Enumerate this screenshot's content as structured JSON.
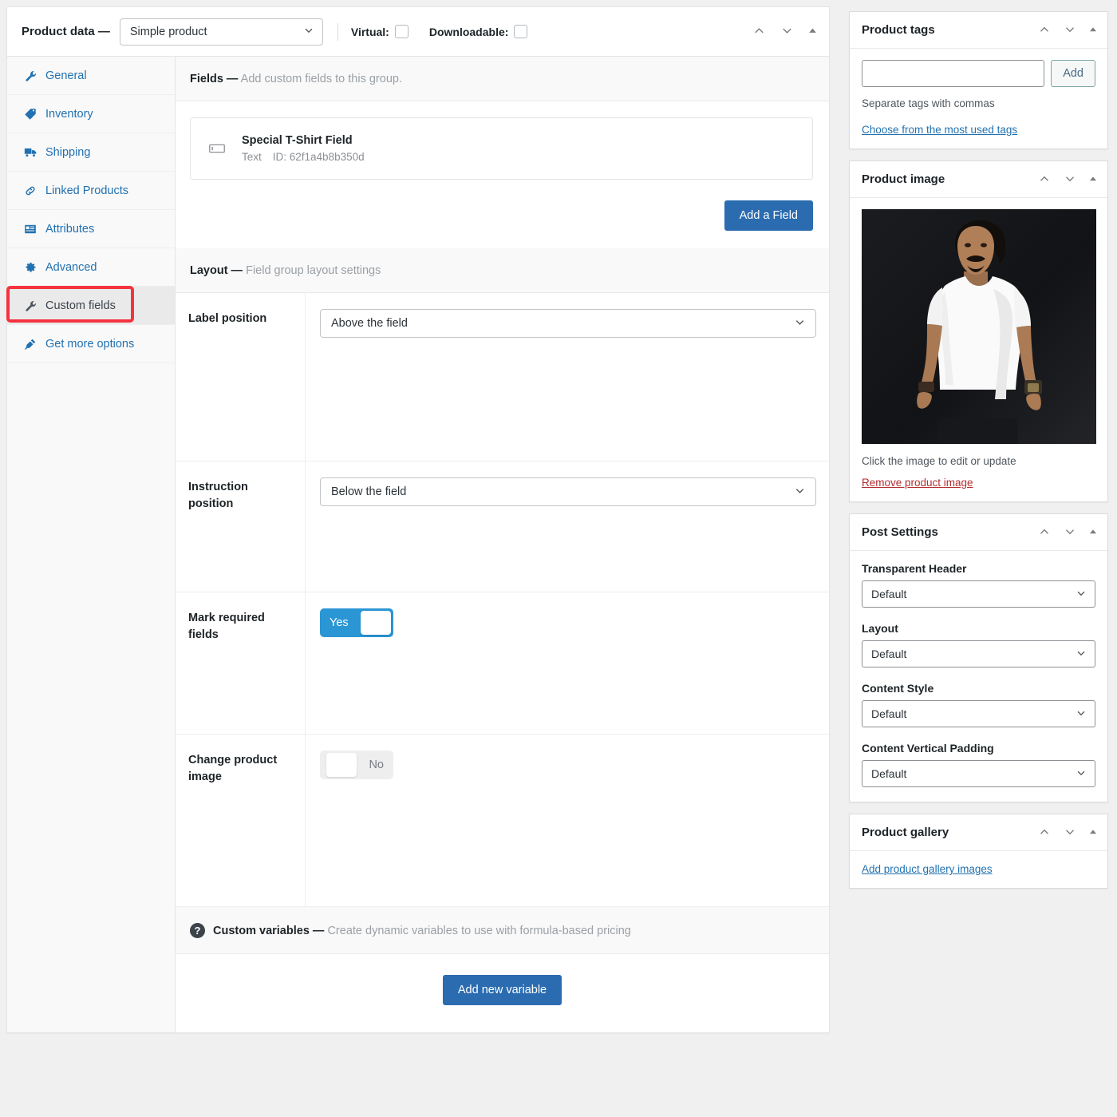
{
  "product_data": {
    "title": "Product data —",
    "type_select": {
      "value": "Simple product",
      "icon": "chevron-down-icon"
    },
    "virtual": {
      "label": "Virtual:",
      "checked": false
    },
    "downloadable": {
      "label": "Downloadable:",
      "checked": false
    },
    "header_controls": [
      "chevron-up-icon",
      "chevron-down-icon",
      "caret-up-icon"
    ],
    "tabs": [
      {
        "label": "General",
        "icon": "wrench-icon",
        "active": false
      },
      {
        "label": "Inventory",
        "icon": "tag-icon",
        "active": false
      },
      {
        "label": "Shipping",
        "icon": "truck-icon",
        "active": false
      },
      {
        "label": "Linked Products",
        "icon": "link-icon",
        "active": false
      },
      {
        "label": "Attributes",
        "icon": "list-box-icon",
        "active": false
      },
      {
        "label": "Advanced",
        "icon": "gear-icon",
        "active": false
      },
      {
        "label": "Custom fields",
        "icon": "wrench-icon",
        "active": true
      },
      {
        "label": "Get more options",
        "icon": "plug-icon",
        "active": false
      }
    ],
    "fields_section": {
      "heading": "Fields —",
      "description": "Add custom fields to this group.",
      "field_card": {
        "icon": "text-input-icon",
        "name": "Special T-Shirt Field",
        "type": "Text",
        "id": "ID: 62f1a4b8b350d"
      },
      "add_field_button": "Add a Field"
    },
    "layout_section": {
      "heading": "Layout —",
      "description": "Field group layout settings",
      "rows": [
        {
          "label": "Label position",
          "control": "select",
          "value": "Above the field"
        },
        {
          "label": "Instruction position",
          "control": "select",
          "value": "Below the field"
        },
        {
          "label": "Mark required fields",
          "control": "toggle",
          "value": "Yes",
          "on": true
        },
        {
          "label": "Change product image",
          "control": "toggle",
          "value": "No",
          "on": false
        }
      ]
    },
    "custom_variables_section": {
      "icon": "help-icon",
      "heading": "Custom variables —",
      "description": "Create dynamic variables to use with formula-based pricing",
      "add_button": "Add new variable"
    }
  },
  "sidebar": {
    "product_tags": {
      "title": "Product tags",
      "controls": [
        "chevron-up-icon",
        "chevron-down-icon",
        "caret-up-icon"
      ],
      "input_value": "",
      "input_placeholder": "",
      "add_button": "Add",
      "hint": "Separate tags with commas",
      "most_used_link": "Choose from the most used tags"
    },
    "product_image": {
      "title": "Product image",
      "controls": [
        "chevron-up-icon",
        "chevron-down-icon",
        "caret-up-icon"
      ],
      "image_alt": "Man wearing white t-shirt on dark background",
      "caption": "Click the image to edit or update",
      "remove_link": "Remove product image"
    },
    "post_settings": {
      "title": "Post Settings",
      "controls": [
        "chevron-up-icon",
        "chevron-down-icon",
        "caret-up-icon"
      ],
      "groups": [
        {
          "label": "Transparent Header",
          "value": "Default"
        },
        {
          "label": "Layout",
          "value": "Default"
        },
        {
          "label": "Content Style",
          "value": "Default"
        },
        {
          "label": "Content Vertical Padding",
          "value": "Default"
        }
      ]
    },
    "product_gallery": {
      "title": "Product gallery",
      "controls": [
        "chevron-up-icon",
        "chevron-down-icon",
        "caret-up-icon"
      ],
      "add_link": "Add product gallery images"
    }
  },
  "colors": {
    "accent_blue": "#2271b1",
    "primary_button": "#2b6cb0",
    "toggle_on": "#2b96d4",
    "highlight_red": "#f5333f",
    "danger_link": "#b32d2e",
    "page_bg": "#f0f0f1"
  }
}
